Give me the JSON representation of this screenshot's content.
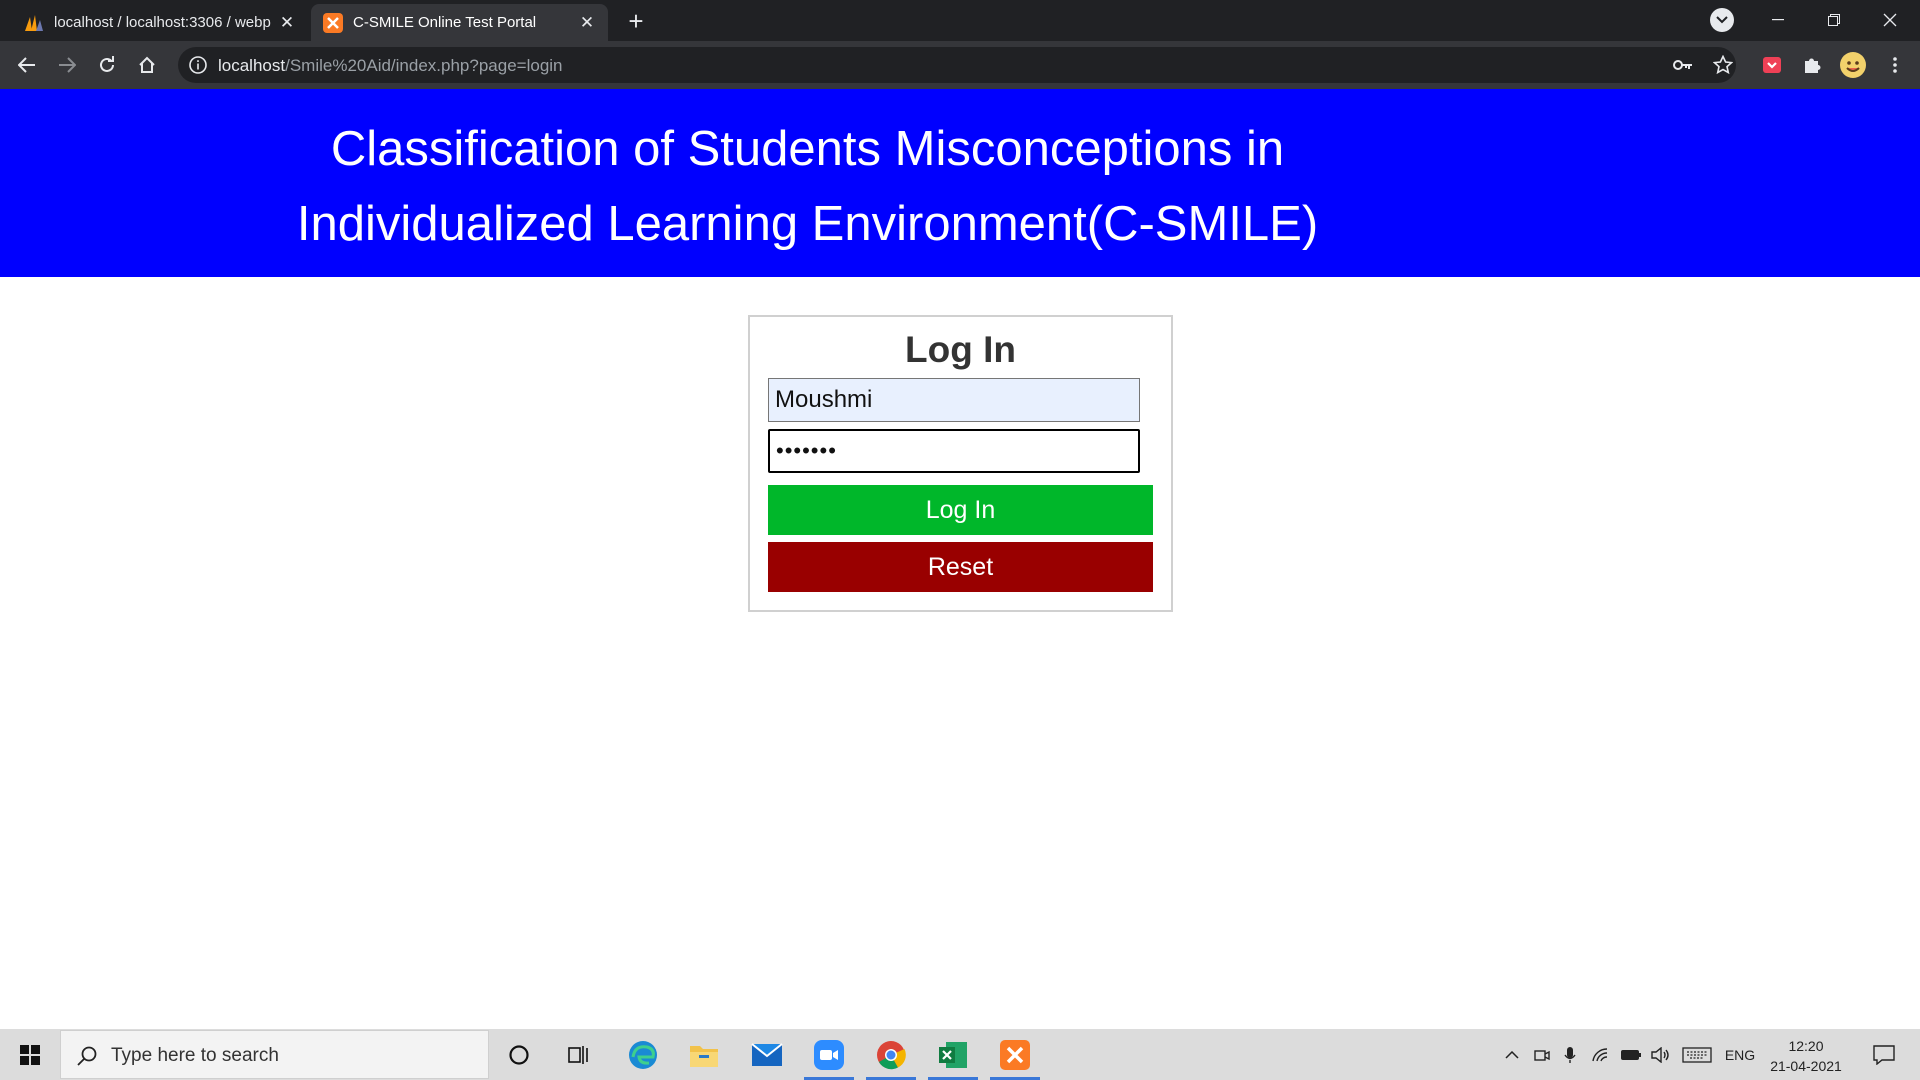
{
  "browser": {
    "tabs": [
      {
        "title": "localhost / localhost:3306 / webp",
        "active": false
      },
      {
        "title": "C-SMILE Online Test Portal",
        "active": true
      }
    ],
    "url": {
      "host": "localhost",
      "path": "/Smile%20Aid/index.php?page=login"
    }
  },
  "page": {
    "banner": {
      "line1": "Classification of Students Misconceptions in",
      "line2": "Individualized Learning Environment(C-SMILE)"
    },
    "login": {
      "heading": "Log In",
      "username_value": "Moushmi",
      "password_value": "•••••••",
      "login_button": "Log In",
      "reset_button": "Reset"
    }
  },
  "taskbar": {
    "search_placeholder": "Type here to search",
    "language": "ENG",
    "time": "12:20",
    "date": "21-04-2021"
  },
  "colors": {
    "banner": "#0000ff",
    "login_button": "#00b72a",
    "reset_button": "#990000",
    "autofill_field": "#e8f0fe"
  }
}
